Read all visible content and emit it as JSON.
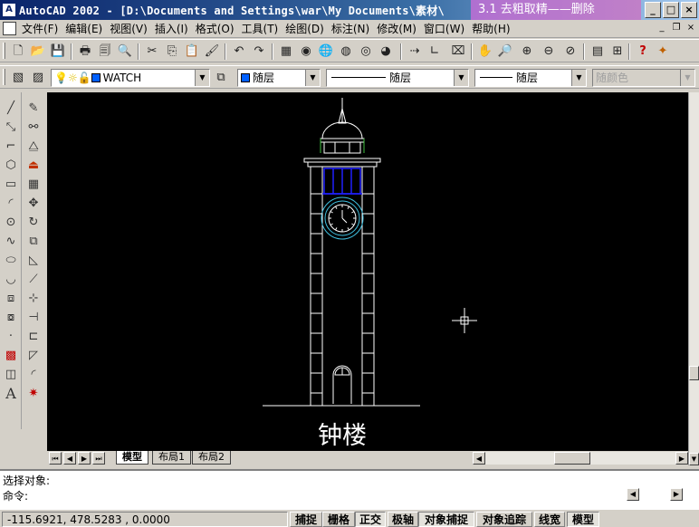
{
  "window": {
    "title": "AutoCAD 2002 - [D:\\Documents and Settings\\war\\My Documents\\素材\\",
    "overlay_caption": "3.1 去粗取精——删除"
  },
  "menu": {
    "items": [
      "文件(F)",
      "编辑(E)",
      "视图(V)",
      "插入(I)",
      "格式(O)",
      "工具(T)",
      "绘图(D)",
      "标注(N)",
      "修改(M)",
      "窗口(W)",
      "帮助(H)"
    ]
  },
  "properties_toolbar": {
    "layer_name": "WATCH",
    "color_value": "随层",
    "linetype_value": "随层",
    "lineweight_value": "随层",
    "plotstyle_value": "随颜色"
  },
  "drawing": {
    "label": "钟楼",
    "colors": {
      "outline": "#ffffff",
      "window_frame": "#2020ff",
      "clock_ring": "#40c0e0",
      "eave_accent": "#40c040"
    }
  },
  "layout_tabs": [
    "模型",
    "布局1",
    "布局2"
  ],
  "command_window": {
    "line1": "选择对象:",
    "line2": "命令:"
  },
  "status": {
    "coordinates": "-115.6921, 478.5283 , 0.0000",
    "toggles": [
      {
        "label": "捕捉",
        "on": false
      },
      {
        "label": "栅格",
        "on": false
      },
      {
        "label": "正交",
        "on": true
      },
      {
        "label": "极轴",
        "on": false
      },
      {
        "label": "对象捕捉",
        "on": true
      },
      {
        "label": "对象追踪",
        "on": false
      },
      {
        "label": "线宽",
        "on": false
      },
      {
        "label": "模型",
        "on": true
      }
    ]
  }
}
